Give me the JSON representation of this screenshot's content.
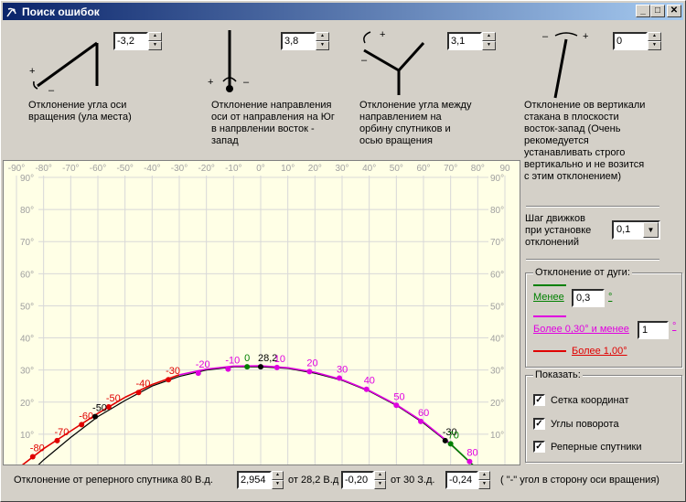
{
  "window": {
    "title": "Поиск ошибок",
    "icon": "satellite-dish-icon",
    "buttons": {
      "minimize": "_",
      "maximize": "□",
      "close": "✕"
    }
  },
  "params": [
    {
      "value": "-3,2",
      "description": "Отклонение угла оси\nвращения (ула места)",
      "icon": "elevation-angle-icon",
      "plus": "+",
      "minus": "–"
    },
    {
      "value": "3,8",
      "description": "Отклонение направления\nоси от направления на Юг\nв напрвлении восток -\nзапад",
      "icon": "azimuth-direction-icon",
      "plus": "+",
      "minus": "–"
    },
    {
      "value": "3,1",
      "description": "Отклонение угла между\nнаправлением на\nорбину спутников и\nосью вращения",
      "icon": "orbit-angle-icon",
      "plus": "+",
      "minus": "–"
    },
    {
      "value": "0",
      "description": "Отклонение ов вертикали\nстакана в  плоскости\nвосток-запад (Очень\nрекомедуется\nустанавливать строго\nвертикально и не возится\nс этим отклонением)",
      "icon": "vertical-tilt-icon",
      "plus": "+",
      "minus": "–"
    }
  ],
  "step": {
    "label": "Шаг движков\nпри установке\nотклонений",
    "value": "0,1"
  },
  "deviation_group": {
    "title": "Отклонение от дуги:",
    "less_label": "Менее",
    "less_value": "0,3",
    "less_unit": "°",
    "more_label": "Более 0,30° и менее",
    "more_value": "1",
    "more_unit": "°",
    "over_label": "Более 1,00°",
    "colors": {
      "less": "#008000",
      "more": "#e000e0",
      "over": "#e00000"
    }
  },
  "show_group": {
    "title": "Показать:",
    "items": [
      {
        "label": "Сетка координат",
        "checked": "✓"
      },
      {
        "label": "Углы поворота",
        "checked": "✓"
      },
      {
        "label": "Реперные спутники",
        "checked": "✓"
      }
    ]
  },
  "bottom": {
    "label1": "Отклонение от реперного спутника 80 В.д.",
    "value1": "2,954",
    "label2": "от 28,2 В.д",
    "value2": "-0,20",
    "label3": "от 30 З.д.",
    "value3": "-0,24",
    "note": "( \"-\" угол в сторону оси вращения)"
  },
  "chart_data": {
    "type": "scatter",
    "x_ticks": [
      "-90°",
      "-80°",
      "-70°",
      "-60°",
      "-50°",
      "-40°",
      "-30°",
      "-20°",
      "-10°",
      "0°",
      "10°",
      "20°",
      "30°",
      "40°",
      "50°",
      "60°",
      "70°",
      "80°",
      "90"
    ],
    "y_ticks": [
      "90°",
      "80°",
      "70°",
      "60°",
      "50°",
      "40°",
      "30°",
      "20°",
      "10°"
    ],
    "xlim": [
      -90,
      90
    ],
    "ylim": [
      0,
      90
    ],
    "grid": true,
    "points": [
      {
        "label": "-80",
        "x": -84,
        "y": 3,
        "color": "#e00000"
      },
      {
        "label": "-70",
        "x": -75,
        "y": 8,
        "color": "#e00000"
      },
      {
        "label": "-60",
        "x": -66,
        "y": 13,
        "color": "#e00000"
      },
      {
        "label": "-50",
        "x": -56,
        "y": 18.5,
        "color": "#e00000"
      },
      {
        "label": "-40",
        "x": -45,
        "y": 23,
        "color": "#e00000"
      },
      {
        "label": "-30",
        "x": -34,
        "y": 27,
        "color": "#e00000"
      },
      {
        "label": "-20",
        "x": -23,
        "y": 29,
        "color": "#e000e0"
      },
      {
        "label": "-10",
        "x": -12,
        "y": 30.3,
        "color": "#e000e0"
      },
      {
        "label": "0",
        "x": -5,
        "y": 31,
        "color": "#008000"
      },
      {
        "label": "28,2",
        "x": 0,
        "y": 31,
        "color": "#000000"
      },
      {
        "label": "10",
        "x": 6,
        "y": 30.8,
        "color": "#e000e0"
      },
      {
        "label": "20",
        "x": 18,
        "y": 29.5,
        "color": "#e000e0"
      },
      {
        "label": "30",
        "x": 29,
        "y": 27.5,
        "color": "#e000e0"
      },
      {
        "label": "40",
        "x": 39,
        "y": 24,
        "color": "#e000e0"
      },
      {
        "label": "50",
        "x": 50,
        "y": 19,
        "color": "#e000e0"
      },
      {
        "label": "60",
        "x": 59,
        "y": 14,
        "color": "#e000e0"
      },
      {
        "label": "-30",
        "x": 68,
        "y": 8,
        "color": "#000000"
      },
      {
        "label": "70",
        "x": 70,
        "y": 7,
        "color": "#008000"
      },
      {
        "label": "80",
        "x": 77,
        "y": 1.5,
        "color": "#e000e0"
      },
      {
        "label": "-50",
        "x": -61,
        "y": 15.5,
        "color": "#000000"
      }
    ],
    "curve_black": [
      [
        -90,
        -6
      ],
      [
        -80,
        2
      ],
      [
        -70,
        9
      ],
      [
        -60,
        15.5
      ],
      [
        -50,
        20.5
      ],
      [
        -40,
        25
      ],
      [
        -30,
        28
      ],
      [
        -20,
        30
      ],
      [
        -10,
        31
      ],
      [
        0,
        31
      ],
      [
        10,
        30.5
      ],
      [
        20,
        29
      ],
      [
        30,
        26.8
      ],
      [
        40,
        23.4
      ],
      [
        50,
        19
      ],
      [
        60,
        13.5
      ],
      [
        70,
        6.8
      ],
      [
        80,
        -1
      ]
    ],
    "curve_colored": [
      [
        -90,
        -1
      ],
      [
        -80,
        5.5
      ],
      [
        -70,
        11
      ],
      [
        -60,
        16.5
      ],
      [
        -50,
        21.5
      ],
      [
        -40,
        25.5
      ],
      [
        -30,
        28.5
      ],
      [
        -20,
        30.3
      ],
      [
        -10,
        31.2
      ],
      [
        0,
        31.3
      ],
      [
        10,
        30.7
      ],
      [
        20,
        29.3
      ],
      [
        30,
        27
      ],
      [
        40,
        23.6
      ],
      [
        50,
        19.2
      ],
      [
        60,
        13.8
      ],
      [
        70,
        7
      ],
      [
        80,
        -1
      ]
    ]
  }
}
